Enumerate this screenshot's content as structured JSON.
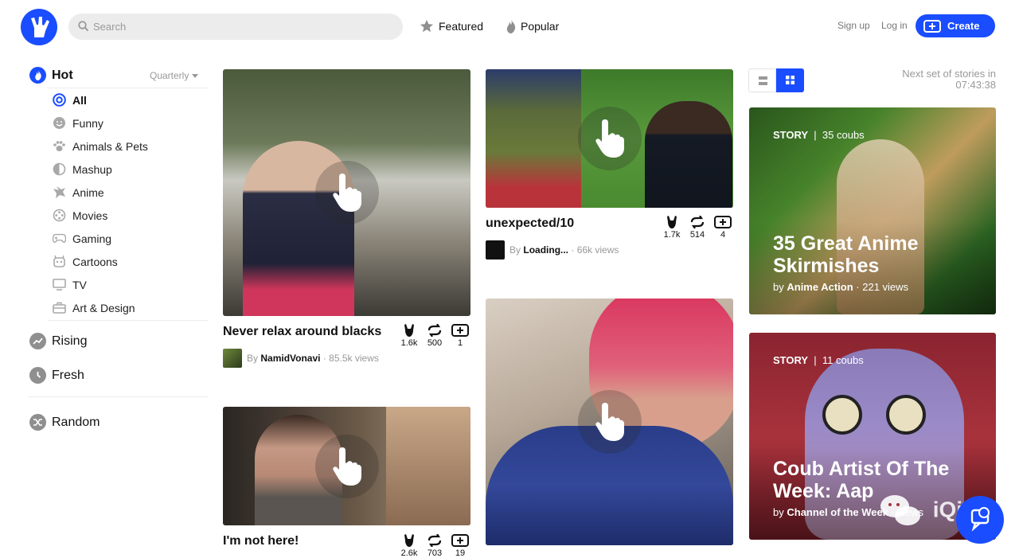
{
  "header": {
    "search_placeholder": "Search",
    "nav": [
      {
        "label": "Featured",
        "icon": "star-icon"
      },
      {
        "label": "Popular",
        "icon": "flame-icon"
      }
    ],
    "signup": "Sign up",
    "login": "Log in",
    "create": "Create"
  },
  "sidebar": {
    "hot": {
      "label": "Hot",
      "period": "Quarterly"
    },
    "categories": [
      {
        "label": "All",
        "icon": "target-icon",
        "active": true
      },
      {
        "label": "Funny",
        "icon": "smiley-icon"
      },
      {
        "label": "Animals & Pets",
        "icon": "paw-icon"
      },
      {
        "label": "Mashup",
        "icon": "half-circle-icon"
      },
      {
        "label": "Anime",
        "icon": "anime-icon"
      },
      {
        "label": "Movies",
        "icon": "film-reel-icon"
      },
      {
        "label": "Gaming",
        "icon": "gamepad-icon"
      },
      {
        "label": "Cartoons",
        "icon": "cartoon-icon"
      },
      {
        "label": "TV",
        "icon": "tv-icon"
      },
      {
        "label": "Art & Design",
        "icon": "briefcase-icon"
      }
    ],
    "rising": "Rising",
    "fresh": "Fresh",
    "random": "Random"
  },
  "feed": {
    "left": [
      {
        "title": "Never relax around blacks",
        "likes": "1.6k",
        "recoubs": "500",
        "bookmarks": "1",
        "by": "By",
        "author": "NamidVonavi",
        "views": "· 85.5k views"
      },
      {
        "title": "I'm not here!",
        "likes": "2.6k",
        "recoubs": "703",
        "bookmarks": "19"
      }
    ],
    "middle": [
      {
        "title": "unexpected/10",
        "likes": "1.7k",
        "recoubs": "514",
        "bookmarks": "4",
        "by": "By",
        "author": "Loading...",
        "views": "· 66k views"
      }
    ]
  },
  "stories_panel": {
    "next_set_label": "Next set of stories in",
    "countdown": "07:43:38",
    "stories": [
      {
        "tag": "STORY",
        "count": "35 coubs",
        "title": "35 Great Anime Skirmishes",
        "by": "by",
        "author": "Anime Action",
        "views": "· 221 views"
      },
      {
        "tag": "STORY",
        "count": "11 coubs",
        "title": "Coub Artist Of The Week: Aap",
        "by": "by",
        "author": "Channel of the Week",
        "views": "· views"
      }
    ]
  },
  "overlay": {
    "watermark": "iQiQi"
  },
  "colors": {
    "accent": "#1a4dff"
  }
}
